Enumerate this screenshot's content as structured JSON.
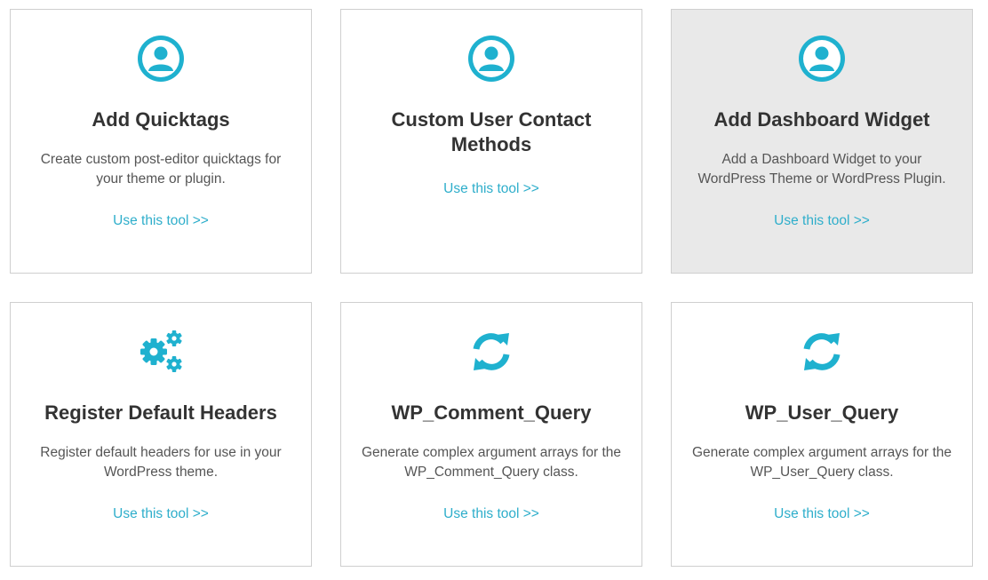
{
  "accent_color": "#1fb1cf",
  "cards": [
    {
      "icon": "user-icon",
      "title": "Add Quicktags",
      "description": "Create custom post-editor quicktags for your theme or plugin.",
      "link": "Use this tool >>"
    },
    {
      "icon": "user-icon",
      "title": "Custom User Contact Methods",
      "description": "",
      "link": "Use this tool >>"
    },
    {
      "icon": "user-icon",
      "title": "Add Dashboard Widget",
      "description": "Add a Dashboard Widget to your WordPress Theme or WordPress Plugin.",
      "link": "Use this tool >>"
    },
    {
      "icon": "gears-icon",
      "title": "Register Default Headers",
      "description": "Register default headers for use in your WordPress theme.",
      "link": "Use this tool >>"
    },
    {
      "icon": "refresh-icon",
      "title": "WP_Comment_Query",
      "description": "Generate complex argument arrays for the WP_Comment_Query class.",
      "link": "Use this tool >>"
    },
    {
      "icon": "refresh-icon",
      "title": "WP_User_Query",
      "description": "Generate complex argument arrays for the WP_User_Query class.",
      "link": "Use this tool >>"
    }
  ]
}
